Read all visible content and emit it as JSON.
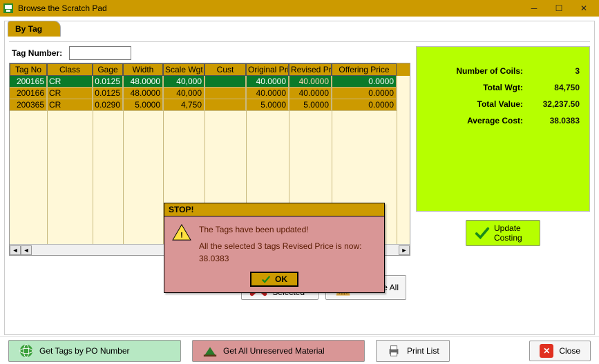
{
  "window": {
    "title": "Browse the Scratch Pad"
  },
  "tabs": {
    "by_tag": "By Tag"
  },
  "tag_number": {
    "label": "Tag Number:",
    "value": ""
  },
  "grid": {
    "headers": [
      "Tag No",
      "Class",
      "Gage",
      "Width",
      "Scale Wgt",
      "Cust",
      "Original Pri",
      "Revised Pri",
      "Offering Price"
    ],
    "rows": [
      {
        "sel": true,
        "tag": "200165",
        "class": "CR",
        "gage": "0.0125",
        "width": "48.0000",
        "wgt": "40,000",
        "cust": "",
        "orig": "40.0000",
        "rev": "40.0000",
        "offer": "0.0000"
      },
      {
        "sel": false,
        "tag": "200166",
        "class": "CR",
        "gage": "0.0125",
        "width": "48.0000",
        "wgt": "40,000",
        "cust": "",
        "orig": "40.0000",
        "rev": "40.0000",
        "offer": "0.0000"
      },
      {
        "sel": false,
        "tag": "200365",
        "class": "CR",
        "gage": "0.0290",
        "width": "5.0000",
        "wgt": "4,750",
        "cust": "",
        "orig": "5.0000",
        "rev": "5.0000",
        "offer": "0.0000"
      }
    ]
  },
  "summary": {
    "coils_label": "Number of Coils:",
    "coils": "3",
    "wgt_label": "Total Wgt:",
    "wgt": "84,750",
    "value_label": "Total Value:",
    "value": "32,237.50",
    "avg_label": "Average Cost:",
    "avg": "38.0383",
    "update_label": "Update Costing"
  },
  "actions": {
    "remove_selected": "Remove Selected",
    "remove_all": "Remove All"
  },
  "bottom": {
    "po": "Get Tags by PO Number",
    "unreserved": "Get All Unreserved Material",
    "print": "Print List",
    "close": "Close"
  },
  "dialog": {
    "title": "STOP!",
    "line1": "The Tags have been updated!",
    "line2": "All the selected 3 tags Revised Price is now:  38.0383",
    "ok": "OK"
  }
}
